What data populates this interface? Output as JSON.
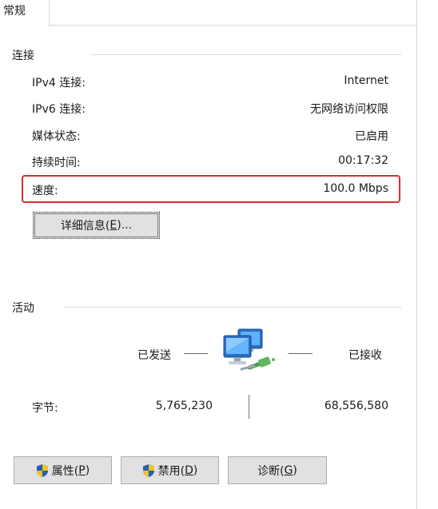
{
  "tab": {
    "label": "常规"
  },
  "connection": {
    "title": "连接",
    "rows": [
      {
        "label": "IPv4 连接:",
        "value": "Internet"
      },
      {
        "label": "IPv6 连接:",
        "value": "无网络访问权限"
      },
      {
        "label": "媒体状态:",
        "value": "已启用"
      },
      {
        "label": "持续时间:",
        "value": "00:17:32"
      },
      {
        "label": "速度:",
        "value": "100.0 Mbps"
      }
    ],
    "details_button": {
      "text": "详细信息(",
      "accel": "E",
      "suffix": ")..."
    }
  },
  "activity": {
    "title": "活动",
    "sent_label": "已发送",
    "received_label": "已接收",
    "bytes_label": "字节:",
    "bytes_sent": "5,765,230",
    "bytes_received": "68,556,580"
  },
  "buttons": {
    "properties": {
      "text": "属性(",
      "accel": "P",
      "suffix": ")"
    },
    "disable": {
      "text": "禁用(",
      "accel": "D",
      "suffix": ")"
    },
    "diagnose": {
      "text": "诊断(",
      "accel": "G",
      "suffix": ")"
    }
  },
  "colors": {
    "highlight": "#d9302c",
    "button_bg": "#e1e1e1"
  },
  "icons": {
    "network": "network-computers-icon",
    "shield": "uac-shield-icon"
  }
}
